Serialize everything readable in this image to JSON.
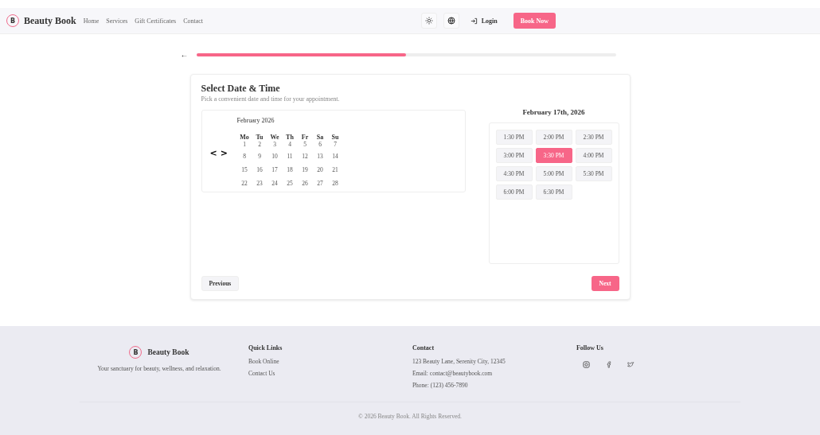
{
  "brand": {
    "name": "Beauty Book",
    "logo_letter": "B"
  },
  "nav": [
    "Home",
    "Services",
    "Gift Certificates",
    "Contact"
  ],
  "header_actions": {
    "login": "Login",
    "book": "Book Now"
  },
  "back": "←",
  "progress": {
    "level": 0.5
  },
  "card": {
    "title": "Select Date & Time",
    "subtitle": "Pick a convenient date and time for your appointment.",
    "calendar": {
      "month": "February 2026",
      "prev": "<",
      "next": ">",
      "weekdays": [
        "Mo",
        "Tu",
        "We",
        "Th",
        "Fr",
        "Sa",
        "Su"
      ],
      "weeks": [
        [
          "1",
          "2",
          "3",
          "4",
          "5",
          "6",
          "7"
        ],
        [
          "8",
          "9",
          "10",
          "11",
          "12",
          "13",
          "14"
        ],
        [
          "15",
          "16",
          "17",
          "18",
          "19",
          "20",
          "21"
        ],
        [
          "22",
          "23",
          "24",
          "25",
          "26",
          "27",
          "28"
        ]
      ]
    },
    "date_heading": "February 17th, 2026",
    "times": [
      {
        "label": "1:30 PM",
        "selected": false
      },
      {
        "label": "2:00 PM",
        "selected": false
      },
      {
        "label": "2:30 PM",
        "selected": false
      },
      {
        "label": "3:00 PM",
        "selected": false
      },
      {
        "label": "3:30 PM",
        "selected": true
      },
      {
        "label": "4:00 PM",
        "selected": false
      },
      {
        "label": "4:30 PM",
        "selected": false
      },
      {
        "label": "5:00 PM",
        "selected": false
      },
      {
        "label": "5:30 PM",
        "selected": false
      },
      {
        "label": "6:00 PM",
        "selected": false
      },
      {
        "label": "6:30 PM",
        "selected": false
      }
    ],
    "previous": "Previous",
    "next": "Next"
  },
  "footer": {
    "brand": "Beauty Book",
    "logo_letter": "B",
    "tagline": "Your sanctuary for beauty, wellness, and relaxation.",
    "quick_links": {
      "title": "Quick Links",
      "items": [
        "Book Online",
        "Contact Us"
      ]
    },
    "contact": {
      "title": "Contact",
      "lines": [
        "123 Beauty Lane, Serenity City, 12345",
        "Email: contact@beautybook.com",
        "Phone: (123) 456-7890"
      ]
    },
    "follow": {
      "title": "Follow Us"
    },
    "copyright": "© 2026 Beauty Book. All Rights Reserved."
  }
}
